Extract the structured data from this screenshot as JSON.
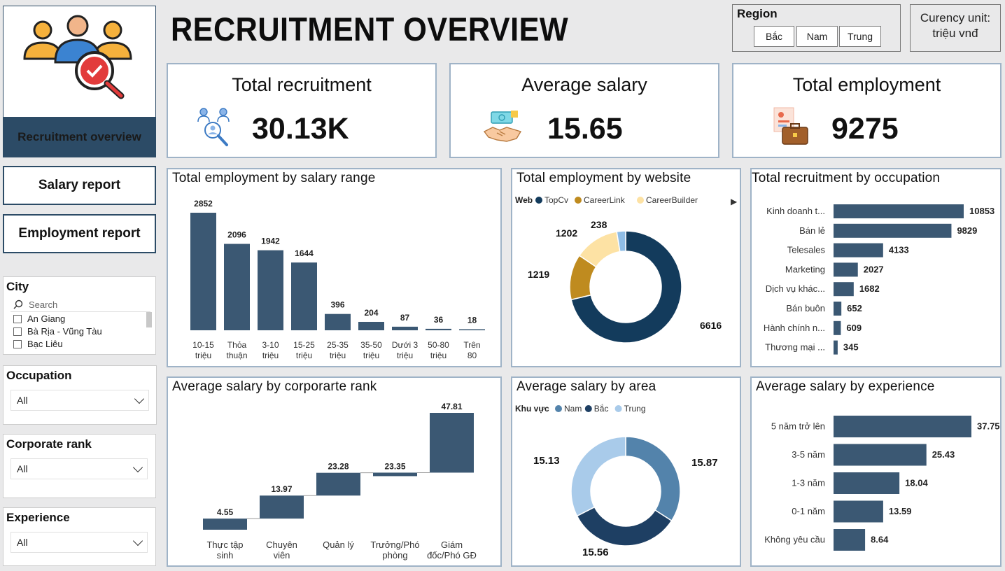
{
  "nav": {
    "overview": "Recruitment overview",
    "salary": "Salary report",
    "employment": "Employment report"
  },
  "header": {
    "title": "RECRUITMENT OVERVIEW"
  },
  "region": {
    "label": "Region",
    "options": [
      "Bắc",
      "Nam",
      "Trung"
    ]
  },
  "currency": {
    "line1": "Curency unit:",
    "line2": "triệu vnđ"
  },
  "kpis": [
    {
      "title": "Total recruitment",
      "value": "30.13K",
      "icon": "recruitment-people-icon"
    },
    {
      "title": "Average salary",
      "value": "15.65",
      "icon": "handshake-money-icon"
    },
    {
      "title": "Total employment",
      "value": "9275",
      "icon": "employment-briefcase-icon"
    }
  ],
  "filters": {
    "city": {
      "title": "City",
      "search_placeholder": "Search",
      "items": [
        "An Giang",
        "Bà Rịa - Vũng Tàu",
        "Bạc Liêu"
      ]
    },
    "occupation": {
      "title": "Occupation",
      "value": "All"
    },
    "rank": {
      "title": "Corporate rank",
      "value": "All"
    },
    "experience": {
      "title": "Experience",
      "value": "All"
    }
  },
  "colors": {
    "bar": "#3b5873",
    "topcv": "#133b5c",
    "careerlink": "#bf8b1f",
    "careerbuilder": "#fde2a4",
    "nam": "#5383ab",
    "bac": "#1e3f63",
    "trung": "#a9cbea",
    "accent": "#2c4b66"
  },
  "chart_data": [
    {
      "type": "bar",
      "title": "Total employment by salary range",
      "categories": [
        "10-15 triệu",
        "Thỏa thuận",
        "3-10 triệu",
        "15-25 triệu",
        "25-35 triệu",
        "35-50 triệu",
        "Dưới 3 triệu",
        "50-80 triệu",
        "Trên 80 triệu"
      ],
      "category_lines": [
        [
          "10-15",
          "triệu"
        ],
        [
          "Thỏa",
          "thuận"
        ],
        [
          "3-10",
          "triệu"
        ],
        [
          "15-25",
          "triệu"
        ],
        [
          "25-35",
          "triệu"
        ],
        [
          "35-50",
          "triệu"
        ],
        [
          "Dưới 3",
          "triệu"
        ],
        [
          "50-80",
          "triệu"
        ],
        [
          "Trên",
          "80"
        ]
      ],
      "values": [
        2852,
        2096,
        1942,
        1644,
        396,
        204,
        87,
        36,
        18
      ]
    },
    {
      "type": "pie",
      "title": "Total employment by website",
      "legend_title": "Web",
      "labels": [
        "TopCv",
        "CareerLink",
        "CareerBuilder"
      ],
      "legend_labels": [
        "TopCv",
        "CareerLink",
        "CareerBuilder"
      ],
      "values": [
        6616,
        1219,
        1202,
        238
      ]
    },
    {
      "type": "bar",
      "orientation": "horizontal",
      "title": "Total recruitment by occupation",
      "categories": [
        "Kinh doanh t...",
        "Bán lẻ",
        "Telesales",
        "Marketing",
        "Dịch vụ khác...",
        "Bán buôn",
        "Hành chính n...",
        "Thương mại ..."
      ],
      "values": [
        10853,
        9829,
        4133,
        2027,
        1682,
        652,
        609,
        345
      ]
    },
    {
      "type": "bar",
      "subtype": "waterfall",
      "title": "Average salary by corporarte rank",
      "categories": [
        "Thực tập sinh",
        "Chuyên viên",
        "Quản lý",
        "Trưởng/Phó phòng",
        "Giám đốc/Phó GĐ"
      ],
      "category_lines": [
        [
          "Thực tập",
          "sinh"
        ],
        [
          "Chuyên",
          "viên"
        ],
        [
          "Quản lý"
        ],
        [
          "Trưởng/Phó",
          "phòng"
        ],
        [
          "Giám",
          "đốc/Phó GĐ"
        ]
      ],
      "values": [
        4.55,
        13.97,
        23.28,
        23.35,
        47.81
      ]
    },
    {
      "type": "pie",
      "title": "Average salary by area",
      "legend_title": "Khu vực",
      "legend_labels": [
        "Nam",
        "Bắc",
        "Trung"
      ],
      "labels": [
        "Nam",
        "Bắc",
        "Trung"
      ],
      "values": [
        15.87,
        15.56,
        15.13
      ]
    },
    {
      "type": "bar",
      "orientation": "horizontal",
      "title": "Average salary by experience",
      "categories": [
        "5 năm trở lên",
        "3-5 năm",
        "1-3 năm",
        "0-1 năm",
        "Không yêu cầu"
      ],
      "values": [
        37.75,
        25.43,
        18.04,
        13.59,
        8.64
      ]
    }
  ]
}
